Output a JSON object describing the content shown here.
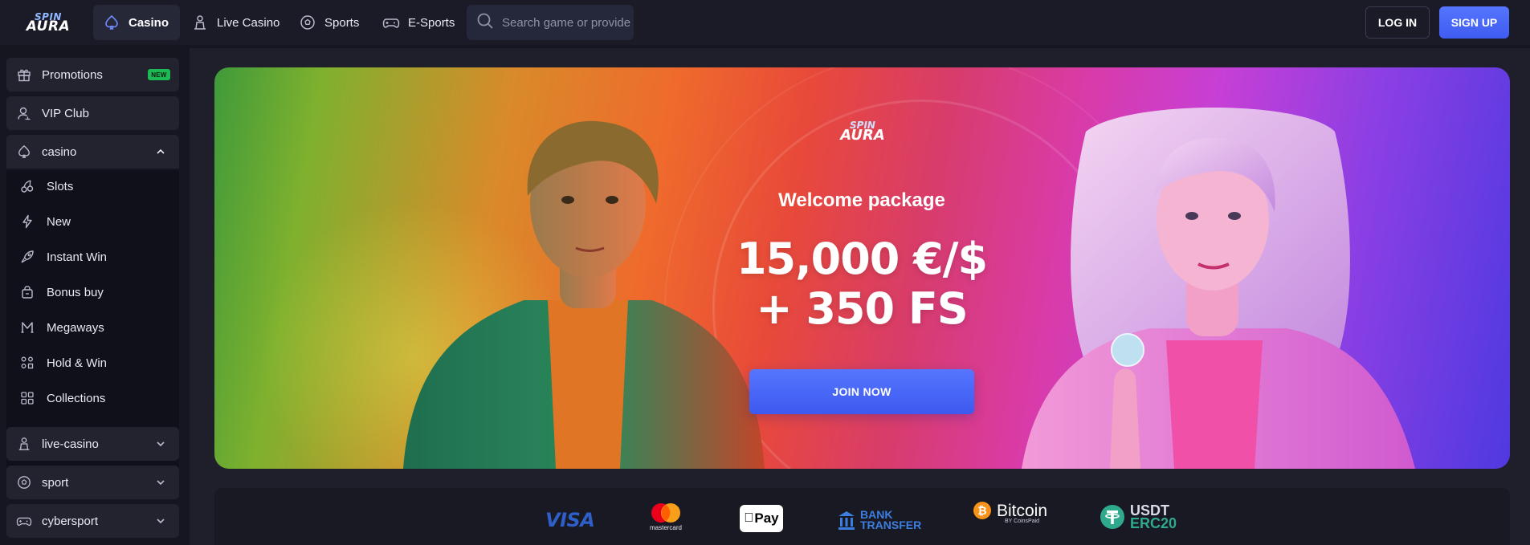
{
  "header": {
    "logo_top": "SPIN",
    "logo_bottom": "AURA",
    "nav": [
      {
        "label": "Casino",
        "icon": "spade-icon",
        "active": true
      },
      {
        "label": "Live Casino",
        "icon": "dealer-icon",
        "active": false
      },
      {
        "label": "Sports",
        "icon": "soccer-ball-icon",
        "active": false
      },
      {
        "label": "E-Sports",
        "icon": "gamepad-icon",
        "active": false
      }
    ],
    "search_placeholder": "Search game or provider",
    "login_label": "LOG IN",
    "signup_label": "SIGN UP"
  },
  "sidebar": {
    "items": [
      {
        "label": "Promotions",
        "icon": "gift-icon",
        "badge": "NEW"
      },
      {
        "label": "VIP Club",
        "icon": "user-icon"
      },
      {
        "label": "casino",
        "icon": "spade-icon",
        "expanded": true
      },
      {
        "label": "live-casino",
        "icon": "dealer-icon",
        "expanded": false
      },
      {
        "label": "sport",
        "icon": "soccer-ball-icon",
        "expanded": false
      },
      {
        "label": "cybersport",
        "icon": "gamepad-icon",
        "expanded": false
      }
    ],
    "casino_sub": [
      {
        "label": "Slots",
        "icon": "cherries-icon"
      },
      {
        "label": "New",
        "icon": "lightning-icon"
      },
      {
        "label": "Instant Win",
        "icon": "rocket-icon"
      },
      {
        "label": "Bonus buy",
        "icon": "shopping-bag-icon"
      },
      {
        "label": "Megaways",
        "icon": "megaways-icon"
      },
      {
        "label": "Hold & Win",
        "icon": "coins-icon"
      },
      {
        "label": "Collections",
        "icon": "grid-icon"
      }
    ]
  },
  "banner": {
    "logo_top": "SPIN",
    "logo_bottom": "AURA",
    "title": "Welcome package",
    "amount": "15,000 €/$",
    "free_spins": "+ 350 FS",
    "cta": "JOIN NOW"
  },
  "payments": {
    "visa": "VISA",
    "mastercard": "mastercard",
    "applepay": "Pay",
    "bank_line1": "BANK",
    "bank_line2": "TRANSFER",
    "bitcoin": "Bitcoin",
    "bitcoin_sub": "BY CoinsPaid",
    "usdt_line1": "USDT",
    "usdt_line2": "ERC20"
  },
  "colors": {
    "accent": "#4a67f7",
    "badge_new": "#1db954",
    "background": "#151620",
    "sidebar_item": "#22232f"
  }
}
